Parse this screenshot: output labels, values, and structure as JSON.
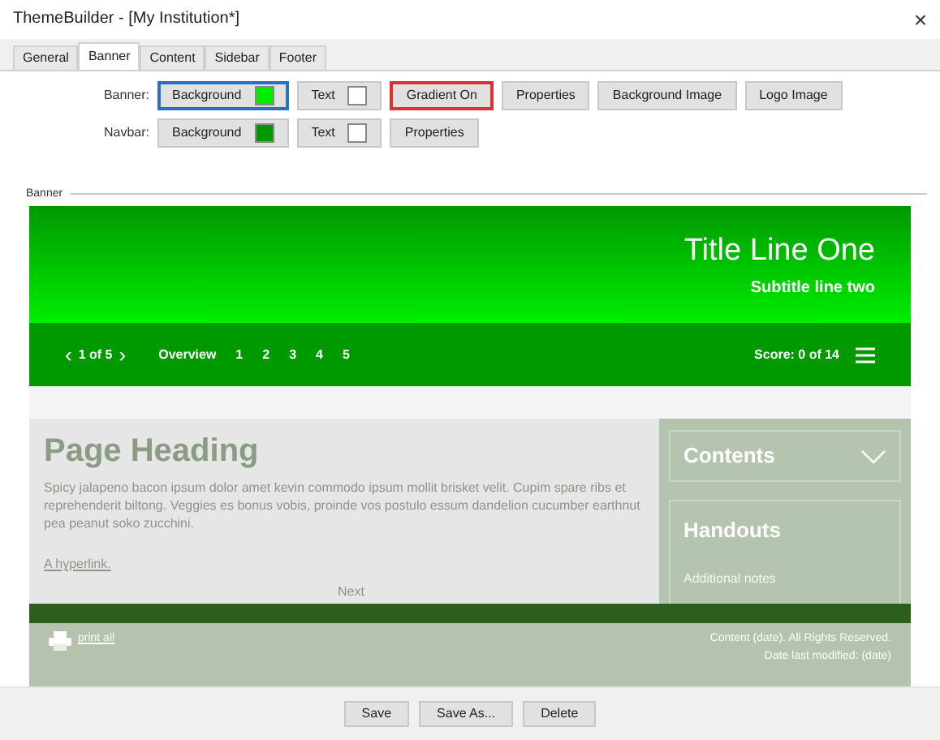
{
  "window": {
    "title": "ThemeBuilder - [My Institution*]",
    "close": "×"
  },
  "tabs": [
    {
      "label": "General",
      "selected": false
    },
    {
      "label": "Banner",
      "selected": true
    },
    {
      "label": "Content",
      "selected": false
    },
    {
      "label": "Sidebar",
      "selected": false
    },
    {
      "label": "Footer",
      "selected": false
    }
  ],
  "settings_rows": [
    {
      "label": "Banner:",
      "buttons": [
        {
          "kind": "swatch",
          "label": "Background",
          "color": "#00ee00",
          "focused": true,
          "highlighted": false
        },
        {
          "kind": "swatch",
          "label": "Text",
          "color": "#ffffff",
          "focused": false,
          "highlighted": false
        },
        {
          "kind": "plain",
          "label": "Gradient On",
          "focused": false,
          "highlighted": true
        },
        {
          "kind": "plain",
          "label": "Properties",
          "focused": false,
          "highlighted": false
        },
        {
          "kind": "plain",
          "label": "Background Image",
          "focused": false,
          "highlighted": false
        },
        {
          "kind": "plain",
          "label": "Logo Image",
          "focused": false,
          "highlighted": false
        }
      ]
    },
    {
      "label": "Navbar:",
      "buttons": [
        {
          "kind": "swatch",
          "label": "Background",
          "color": "#009900",
          "focused": false,
          "highlighted": false
        },
        {
          "kind": "swatch",
          "label": "Text",
          "color": "#ffffff",
          "focused": false,
          "highlighted": false
        },
        {
          "kind": "plain",
          "label": "Properties",
          "focused": false,
          "highlighted": false
        }
      ]
    }
  ],
  "preview": {
    "group_label": "Banner",
    "banner": {
      "title": "Title Line One",
      "subtitle": "Subtitle line two"
    },
    "navbar": {
      "prev": "‹",
      "page": "1 of 5",
      "next": "›",
      "overview": "Overview",
      "pages": [
        "1",
        "2",
        "3",
        "4",
        "5"
      ],
      "score": "Score: 0 of 14"
    },
    "content": {
      "heading": "Page Heading",
      "body": "Spicy jalapeno bacon ipsum dolor amet kevin commodo ipsum mollit brisket velit. Cupim spare ribs et reprehenderit biltong. Veggies es bonus vobis, proinde vos postulo essum dandelion cucumber earthnut pea peanut soko zucchini.",
      "link": "A hyperlink.",
      "next": "Next"
    },
    "sidebar": {
      "contents": "Contents",
      "handouts": "Handouts",
      "notes": "Additional notes"
    },
    "footer": {
      "print": "print all",
      "copyright": "Content (date). All Rights Reserved.",
      "modified": "Date last modified: (date)"
    }
  },
  "actions": [
    "Save",
    "Save As...",
    "Delete"
  ]
}
